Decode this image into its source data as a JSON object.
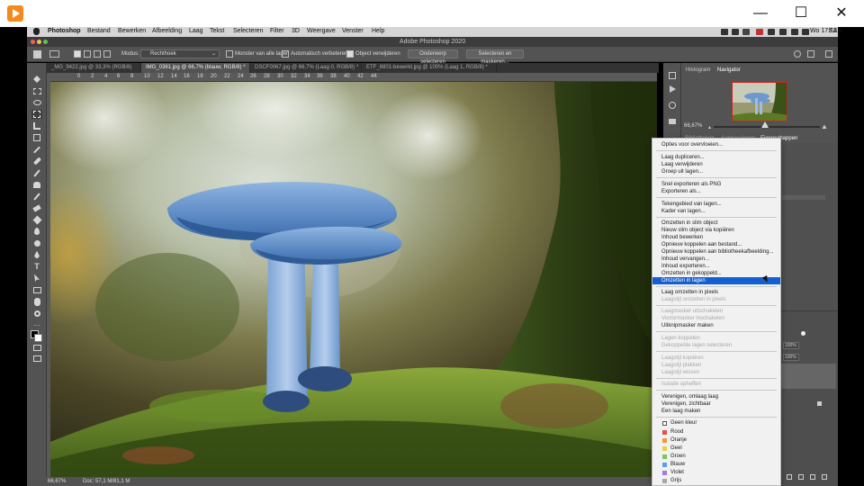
{
  "player": {
    "minimize_glyph": "—",
    "maximize_glyph": "☐",
    "close_glyph": "✕"
  },
  "menubar": {
    "items": [
      "Photoshop",
      "Bestand",
      "Bewerken",
      "Afbeelding",
      "Laag",
      "Tekst",
      "Selecteren",
      "Filter",
      "3D",
      "Weergave",
      "Venster",
      "Help"
    ],
    "clock": "Wo 17:12",
    "user": "EAM"
  },
  "app": {
    "title": "Adobe Photoshop 2020"
  },
  "options": {
    "mode_label": "Modus:",
    "mode_value": "Rechthoek",
    "sample_all_layers": "Monster van alle lagen",
    "auto_enhance": "Automatisch verbeteren",
    "object_subtract": "Object verwijderen",
    "select_subject": "Onderwerp selecteren",
    "select_and_mask": "Selecteren en maskeren..."
  },
  "tabs": [
    "_MG_9422.jpg @ 33,3% (RGB/8)",
    "IMG_0361.jpg @ 66,7% (blauw, RGB/8) *",
    "DSCF0067.jpg @ 66,7% (Laag 0, RGB/8) *",
    "ETF_8801-bewerkt.jpg @ 100% (Laag 1, RGB/8) *"
  ],
  "ruler_ticks": [
    "0",
    "2",
    "4",
    "6",
    "8",
    "10",
    "12",
    "14",
    "16",
    "18",
    "20",
    "22",
    "24",
    "26",
    "28",
    "30",
    "32",
    "34",
    "36",
    "38",
    "40",
    "42",
    "44"
  ],
  "status": {
    "zoom": "66,67%",
    "doc": "Doc: 57,1 M/81,1 M"
  },
  "panels": {
    "tab_histogram": "Histogram",
    "tab_navigator": "Navigator",
    "zoom": "66,67%",
    "tab_libraries": "Bibliotheken",
    "tab_adjustments": "Aanpassingen",
    "tab_properties": "Eigenschappen",
    "opacity": "100%",
    "fill": "100%"
  },
  "context_menu": {
    "items": [
      {
        "label": "Opties voor overvloeien..."
      },
      {
        "label": "Laag dupliceren..."
      },
      {
        "label": "Laag verwijderen"
      },
      {
        "label": "Groep uit lagen..."
      },
      {
        "label": "Snel exporteren als PNG"
      },
      {
        "label": "Exporteren als..."
      },
      {
        "label": "Tekengebied van lagen..."
      },
      {
        "label": "Kader van lagen..."
      },
      {
        "label": "Omzetten in slim object"
      },
      {
        "label": "Nieuw slim object via kopiëren"
      },
      {
        "label": "Inhoud bewerken"
      },
      {
        "label": "Opnieuw koppelen aan bestand..."
      },
      {
        "label": "Opnieuw koppelen aan bibliotheekafbeelding..."
      },
      {
        "label": "Inhoud vervangen..."
      },
      {
        "label": "Inhoud exporteren..."
      },
      {
        "label": "Omzetten in gekoppeld..."
      },
      {
        "label": "Omzetten in lagen"
      },
      {
        "label": "Laag omzetten in pixels"
      },
      {
        "label": "Laagstijl omzetten in pixels"
      },
      {
        "label": "Laagmasker uitschakelen"
      },
      {
        "label": "Vectormasker inschakelen"
      },
      {
        "label": "Uitknipmasker maken"
      },
      {
        "label": "Lagen koppelen"
      },
      {
        "label": "Gekoppelde lagen selecteren"
      },
      {
        "label": "Laagstijl kopiëren"
      },
      {
        "label": "Laagstijl plakken"
      },
      {
        "label": "Laagstijl wissen"
      },
      {
        "label": "Isolatie opheffen"
      },
      {
        "label": "Verenigen, omlaag laag"
      },
      {
        "label": "Verenigen, zichtbaar"
      },
      {
        "label": "Een laag maken"
      },
      {
        "label": "Geen kleur"
      },
      {
        "label": "Rood"
      },
      {
        "label": "Oranje"
      },
      {
        "label": "Geel"
      },
      {
        "label": "Groen"
      },
      {
        "label": "Blauw"
      },
      {
        "label": "Violet"
      },
      {
        "label": "Grijs"
      }
    ],
    "colors": {
      "Rood": "#e5504b",
      "Oranje": "#ef9a3b",
      "Geel": "#e8d246",
      "Groen": "#7fc55a",
      "Blauw": "#5c9ee8",
      "Violet": "#a77bdc",
      "Grijs": "#a7a7a7"
    }
  }
}
